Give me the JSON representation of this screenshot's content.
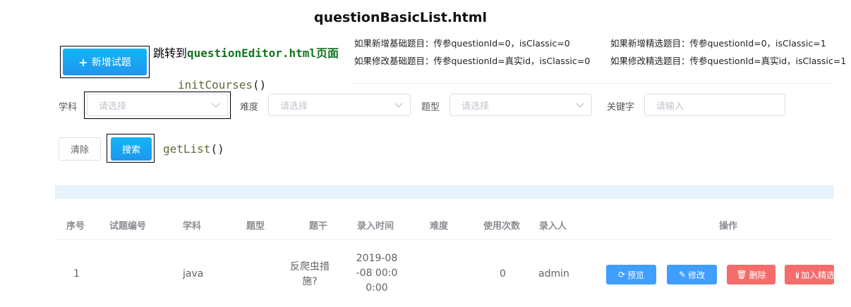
{
  "page_title": "questionBasicList.html",
  "toolbar": {
    "add_icon": "plus-icon",
    "add_label": "新增试题",
    "jump_note_prefix": "跳转到",
    "jump_note_code": "questionEditor.html",
    "jump_note_suffix": "页面"
  },
  "notes": {
    "basic_add": "如果新增基础题目：传参questionId=0，isClassic=0",
    "basic_edit": "如果修改基础题目：传参questionId=真实id，isClassic=0",
    "classic_add": "如果新增精选题目：传参questionId=0，isClassic=1",
    "classic_edit": "如果修改精选题目：传参questionId=真实id，isClassic=1"
  },
  "annotations": {
    "init_fn": "initCourses",
    "search_fn": "getList",
    "parens": "()"
  },
  "filters": {
    "subject_label": "学科",
    "subject_placeholder": "请选择",
    "difficulty_label": "难度",
    "difficulty_placeholder": "请选择",
    "type_label": "题型",
    "type_placeholder": "请选择",
    "keyword_label": "关键字",
    "keyword_placeholder": "请输入",
    "clear_label": "清除",
    "search_label": "搜索"
  },
  "table": {
    "headers": [
      "序号",
      "试题编号",
      "学科",
      "题型",
      "题干",
      "录入时间",
      "难度",
      "使用次数",
      "录入人",
      "操作"
    ],
    "rows": [
      {
        "index": "1",
        "code": "",
        "subject": "java",
        "type": "",
        "stem_line1": "反爬虫措",
        "stem_line2": "施?",
        "time_line1": "2019-08",
        "time_line2": "-08 00:0",
        "time_line3": "0:00",
        "difficulty": "",
        "use_count": "0",
        "creator": "admin",
        "actions": {
          "preview": "预览",
          "edit": "修改",
          "delete": "删除",
          "add_classic": "加入精选"
        }
      }
    ]
  },
  "colors": {
    "primary": "#1e96ef",
    "action_blue": "#409eff",
    "action_red": "#f56c6c",
    "annotation_green": "#13751f",
    "table_band": "#e5f3fc"
  }
}
